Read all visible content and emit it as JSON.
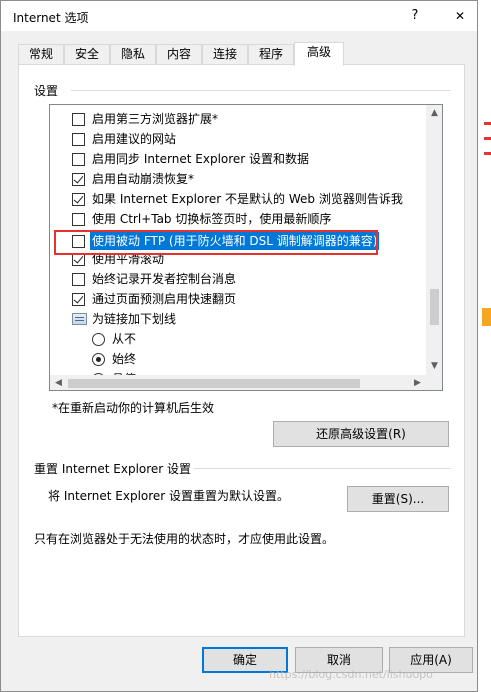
{
  "window": {
    "title": "Internet 选项",
    "help_glyph": "?",
    "close_glyph": "✕"
  },
  "tabs": [
    {
      "label": "常规",
      "active": false
    },
    {
      "label": "安全",
      "active": false
    },
    {
      "label": "隐私",
      "active": false
    },
    {
      "label": "内容",
      "active": false
    },
    {
      "label": "连接",
      "active": false
    },
    {
      "label": "程序",
      "active": false
    },
    {
      "label": "高级",
      "active": true
    }
  ],
  "settings": {
    "group_label": "设置",
    "items": [
      {
        "type": "checkbox",
        "checked": false,
        "label": "启用第三方浏览器扩展*"
      },
      {
        "type": "checkbox",
        "checked": false,
        "label": "启用建议的网站"
      },
      {
        "type": "checkbox",
        "checked": false,
        "label": "启用同步 Internet Explorer 设置和数据"
      },
      {
        "type": "checkbox",
        "checked": true,
        "label": "启用自动崩溃恢复*"
      },
      {
        "type": "checkbox",
        "checked": true,
        "label": "如果 Internet Explorer 不是默认的 Web 浏览器则告诉我"
      },
      {
        "type": "checkbox",
        "checked": false,
        "label": "使用 Ctrl+Tab 切换标签页时，使用最新顺序"
      },
      {
        "type": "checkbox",
        "checked": false,
        "label": "使用被动 FTP (用于防火墙和 DSL 调制解调器的兼容)",
        "highlighted": true
      },
      {
        "type": "checkbox",
        "checked": true,
        "label": "使用平滑滚动"
      },
      {
        "type": "checkbox",
        "checked": false,
        "label": "始终记录开发者控制台消息"
      },
      {
        "type": "checkbox",
        "checked": true,
        "label": "通过页面预测启用快速翻页"
      },
      {
        "type": "category",
        "label": "为链接加下划线"
      },
      {
        "type": "radio",
        "selected": false,
        "label": "从不"
      },
      {
        "type": "radio",
        "selected": true,
        "label": "始终"
      },
      {
        "type": "radio",
        "selected": false,
        "label": "悬停"
      }
    ],
    "scroll_up": "▲",
    "scroll_down": "▼",
    "scroll_left": "◀",
    "scroll_right": "▶",
    "restart_note": "*在重新启动你的计算机后生效",
    "restore_button": "还原高级设置(R)"
  },
  "reset": {
    "group_label": "重置 Internet Explorer 设置",
    "description": "将 Internet Explorer 设置重置为默认设置。",
    "reset_button": "重置(S)...",
    "note": "只有在浏览器处于无法使用的状态时，才应使用此设置。"
  },
  "footer": {
    "ok_button": "确定",
    "cancel_button": "取消",
    "apply_button": "应用(A)"
  },
  "watermark": "https://blog.csdn.net/lishuopo",
  "colors": {
    "highlight": "#0078d7",
    "annotation_box": "#e8312d"
  }
}
